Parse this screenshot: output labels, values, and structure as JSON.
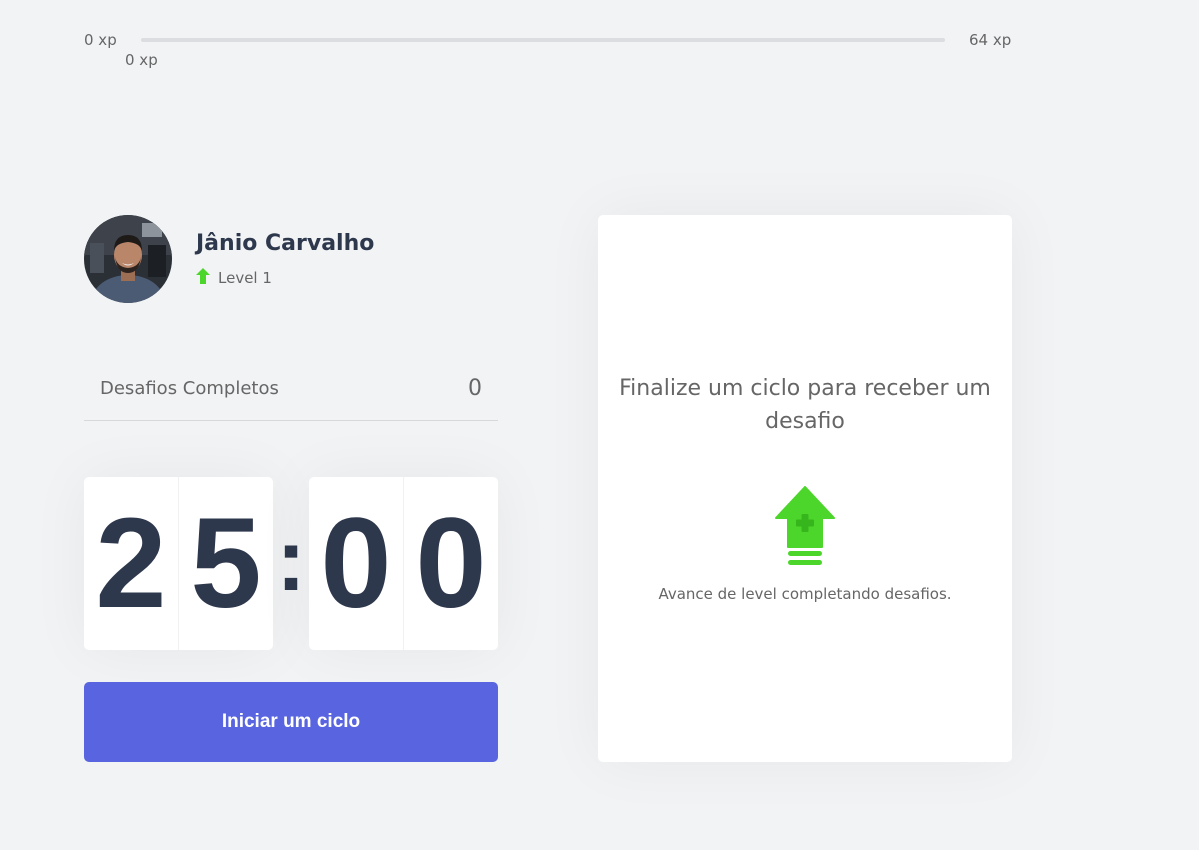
{
  "experience": {
    "start_label": "0 xp",
    "current_label": "0 xp",
    "end_label": "64 xp",
    "progress_fraction": 0
  },
  "profile": {
    "name": "Jânio Carvalho",
    "level_text": "Level 1",
    "level_icon": "level-up-arrow-icon"
  },
  "completed_challenges": {
    "label": "Desafios Completos",
    "count": "0"
  },
  "countdown": {
    "minute_left": "2",
    "minute_right": "5",
    "separator": ":",
    "second_left": "0",
    "second_right": "0"
  },
  "start_button": {
    "label": "Iniciar um ciclo"
  },
  "challenge_box": {
    "title": "Finalize um ciclo para receber um desafio",
    "icon": "level-up-icon",
    "hint": "Avance de level completando desafios."
  },
  "colors": {
    "background": "#f2f3f5",
    "text": "#666666",
    "title": "#2e384d",
    "green": "#4cd62b",
    "blue": "#5965e0",
    "white": "#ffffff"
  }
}
